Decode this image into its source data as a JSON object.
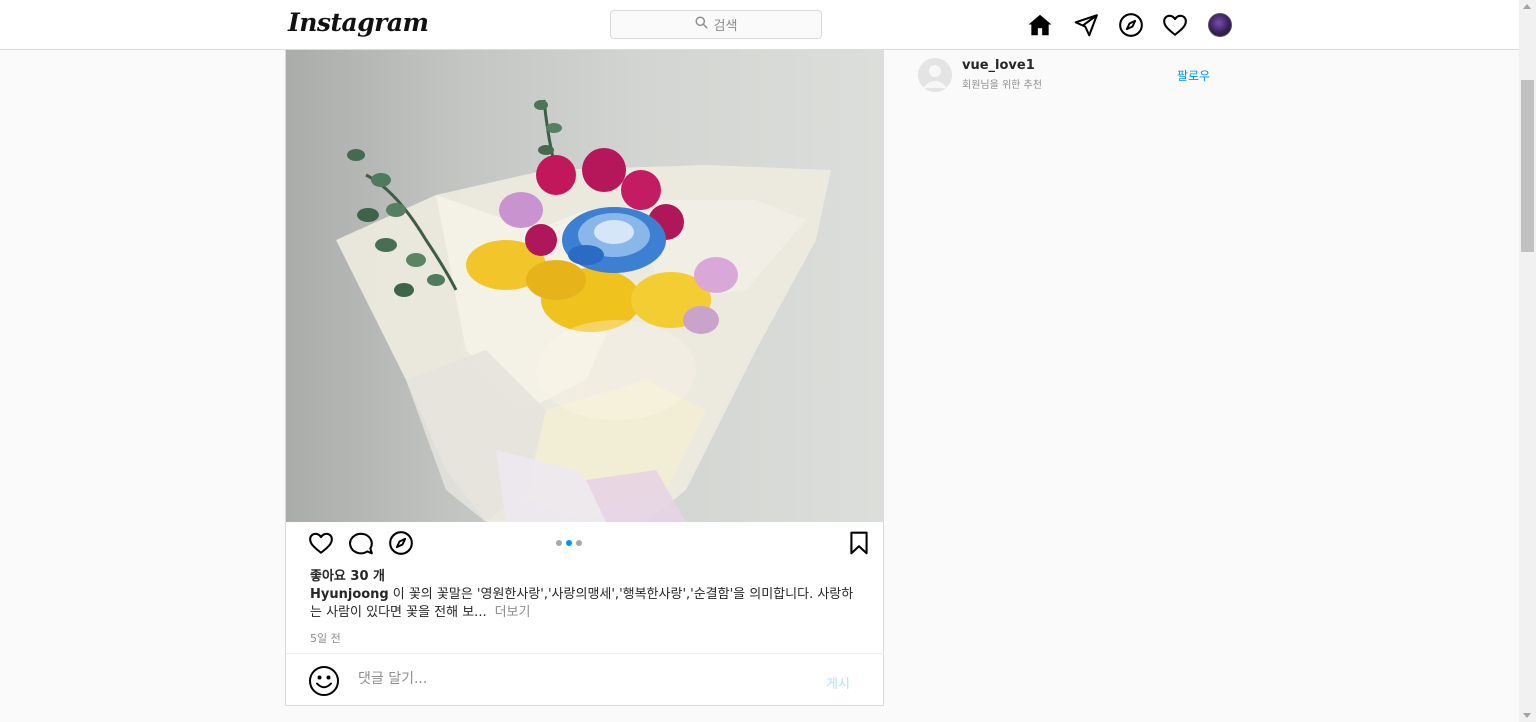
{
  "header": {
    "logo": "Instagram",
    "search_placeholder": "검색",
    "icons": [
      "home-icon",
      "direct-message-icon",
      "explore-icon",
      "activity-heart-icon",
      "profile-avatar"
    ]
  },
  "post": {
    "image_alt": "flower bouquet photo",
    "carousel": {
      "total": 3,
      "active": 2
    },
    "likes": "좋아요 30 개",
    "author": "Hyunjoong",
    "caption": "이 꽃의 꽃말은 '영원한사랑','사랑의맹세','행복한사랑','순결함'을 의미합니다. 사랑하는 사람이 있다면 꽃을 전해 보...",
    "more": "더보기",
    "time": "5일 전",
    "comment_placeholder": "댓글 달기...",
    "post_button": "게시"
  },
  "suggestion": {
    "username": "vue_love1",
    "subtitle": "회원님을 위한 추천",
    "follow": "팔로우"
  },
  "colors": {
    "accent": "#0095f6",
    "accent_disabled": "#b2dffc",
    "border": "#dbdbdb",
    "muted": "#8e8e8e"
  }
}
